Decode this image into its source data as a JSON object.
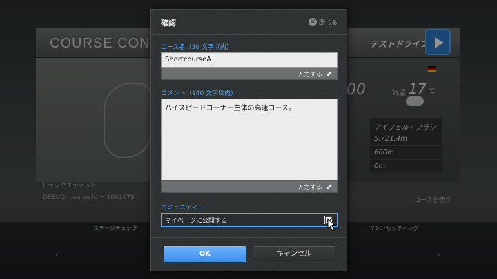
{
  "background": {
    "title": "COURSE CONDITI",
    "test_drive": "テストドライブ",
    "time": "00",
    "weather_label": "気温",
    "temperature": "17",
    "temperature_unit": "℃",
    "rows": [
      "アイフェル・フラット",
      "5,721.4m",
      "600m",
      "0m"
    ],
    "debug_text": "DEBUG: course id = 1001679",
    "bottom_labels": [
      "ステージチェック",
      "マシンセッティング"
    ],
    "label_left": "トラックエディット",
    "label_right": "コースを使う"
  },
  "dialog": {
    "title": "確認",
    "close_label": "閉じる",
    "course_name": {
      "label": "コース名（30 文字以内）",
      "value": "ShortcourseA",
      "input_label": "入力する"
    },
    "comment": {
      "label": "コメント（140 文字以内）",
      "value": "ハイスピードコーナー主体の高速コース。",
      "input_label": "入力する"
    },
    "community": {
      "label": "コミュニティー",
      "checkbox_label": "マイページに公開する",
      "checked": true
    },
    "ok_label": "OK",
    "cancel_label": "キャンセル"
  },
  "colors": {
    "accent": "#5aa8ff",
    "ok_button": "#3d8ce8",
    "dialog_bg": "#2e3131"
  }
}
